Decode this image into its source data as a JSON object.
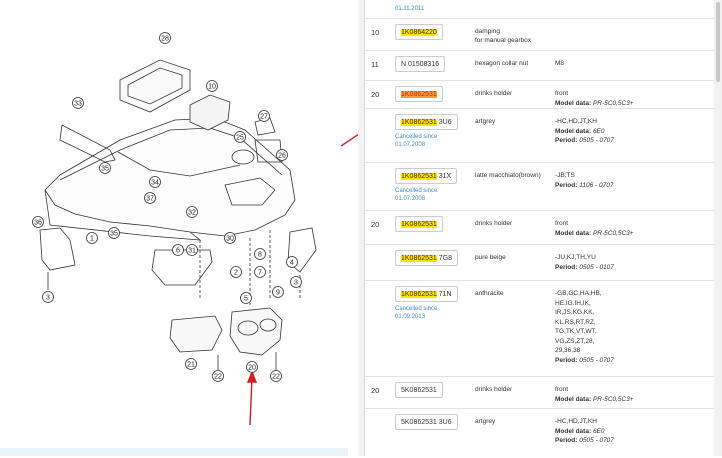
{
  "top_date": "01.11.2011",
  "parts": [
    {
      "pos": "10",
      "number": "1K0864220",
      "suffix": "",
      "desc": "damping\nfor manual gearbox",
      "note_lines": [],
      "cancel": ""
    },
    {
      "pos": "11",
      "number": "N 01508316",
      "suffix": "",
      "desc": "hexagon collar nut",
      "note_lines": [
        "M8"
      ],
      "cancel": ""
    },
    {
      "pos": "20",
      "number": "1K0862531",
      "suffix": "",
      "desc": "drinks holder",
      "note_lines": [
        "front"
      ],
      "model_label": "Model data:",
      "model": "PR-5C0,5C3+",
      "cancel": ""
    },
    {
      "pos": "",
      "number": "1K0862531",
      "suffix": " 3U6",
      "desc": "artgrey",
      "note_lines": [
        "-HC,HD,JT,KH"
      ],
      "model_label": "Model data:",
      "model": "6E0",
      "period_label": "Period:",
      "period": "0505 - 0707",
      "cancel": "Cancelled since\n01.07.2008"
    },
    {
      "pos": "",
      "number": "1K0862531",
      "suffix": " 31X",
      "desc": "latte macchiato(brown)",
      "note_lines": [
        "-JB,TS"
      ],
      "period_label": "Period:",
      "period": "1106 - 0707",
      "cancel": "Cancelled since\n01.07.2008"
    },
    {
      "pos": "20",
      "number": "1K0862531",
      "suffix": "",
      "desc": "drinks holder",
      "note_lines": [
        "front"
      ],
      "model_label": "Model data:",
      "model": "PR-5C0,5C3+",
      "cancel": ""
    },
    {
      "pos": "",
      "number": "1K0862531",
      "suffix": " 7G8",
      "desc": "pure beige",
      "note_lines": [
        "-JU,KJ,TH,YU"
      ],
      "period_label": "Period:",
      "period": "0505 - 0107",
      "cancel": ""
    },
    {
      "pos": "",
      "number": "1K0862531",
      "suffix": " 71N",
      "desc": "anthracite",
      "note_lines": [
        "-GB,GC,HA,HB,",
        "HE,IG,IH,IK,",
        "IR,JS,KG,KK,",
        "KL,RS,RT,RZ,",
        "TG,TK,VT,WT,",
        "VG,ZS,ZT,28,",
        "29,36,38"
      ],
      "period_label": "Period:",
      "period": "0505 - 0707",
      "cancel": "Cancelled since\n01.09.2013"
    },
    {
      "pos": "20",
      "number": "5K0862531",
      "suffix": "",
      "desc": "drinks holder",
      "note_lines": [
        "front"
      ],
      "model_label": "Model data:",
      "model": "PR-5C0,5C3+",
      "cancel": ""
    },
    {
      "pos": "",
      "number": "5K0862531",
      "suffix": " 3U6",
      "desc": "artgrey",
      "note_lines": [
        "-HC,HD,JT,KH"
      ],
      "model_label": "Model data:",
      "model": "6E0",
      "period_label": "Period:",
      "period": "0505 - 0707",
      "cancel": ""
    }
  ],
  "callouts": [
    "33",
    "28",
    "10",
    "35",
    "34",
    "37",
    "36",
    "1",
    "3",
    "31",
    "32",
    "35",
    "27",
    "25",
    "26",
    "4",
    "30",
    "6",
    "8",
    "2",
    "7",
    "3",
    "5",
    "9",
    "21",
    "22",
    "20",
    "22"
  ],
  "colors": {
    "highlight": "#ffe400",
    "highlight_active": "#ff9a3c",
    "link_blue": "#3a8ac9",
    "arrow_red": "#cc2222"
  }
}
